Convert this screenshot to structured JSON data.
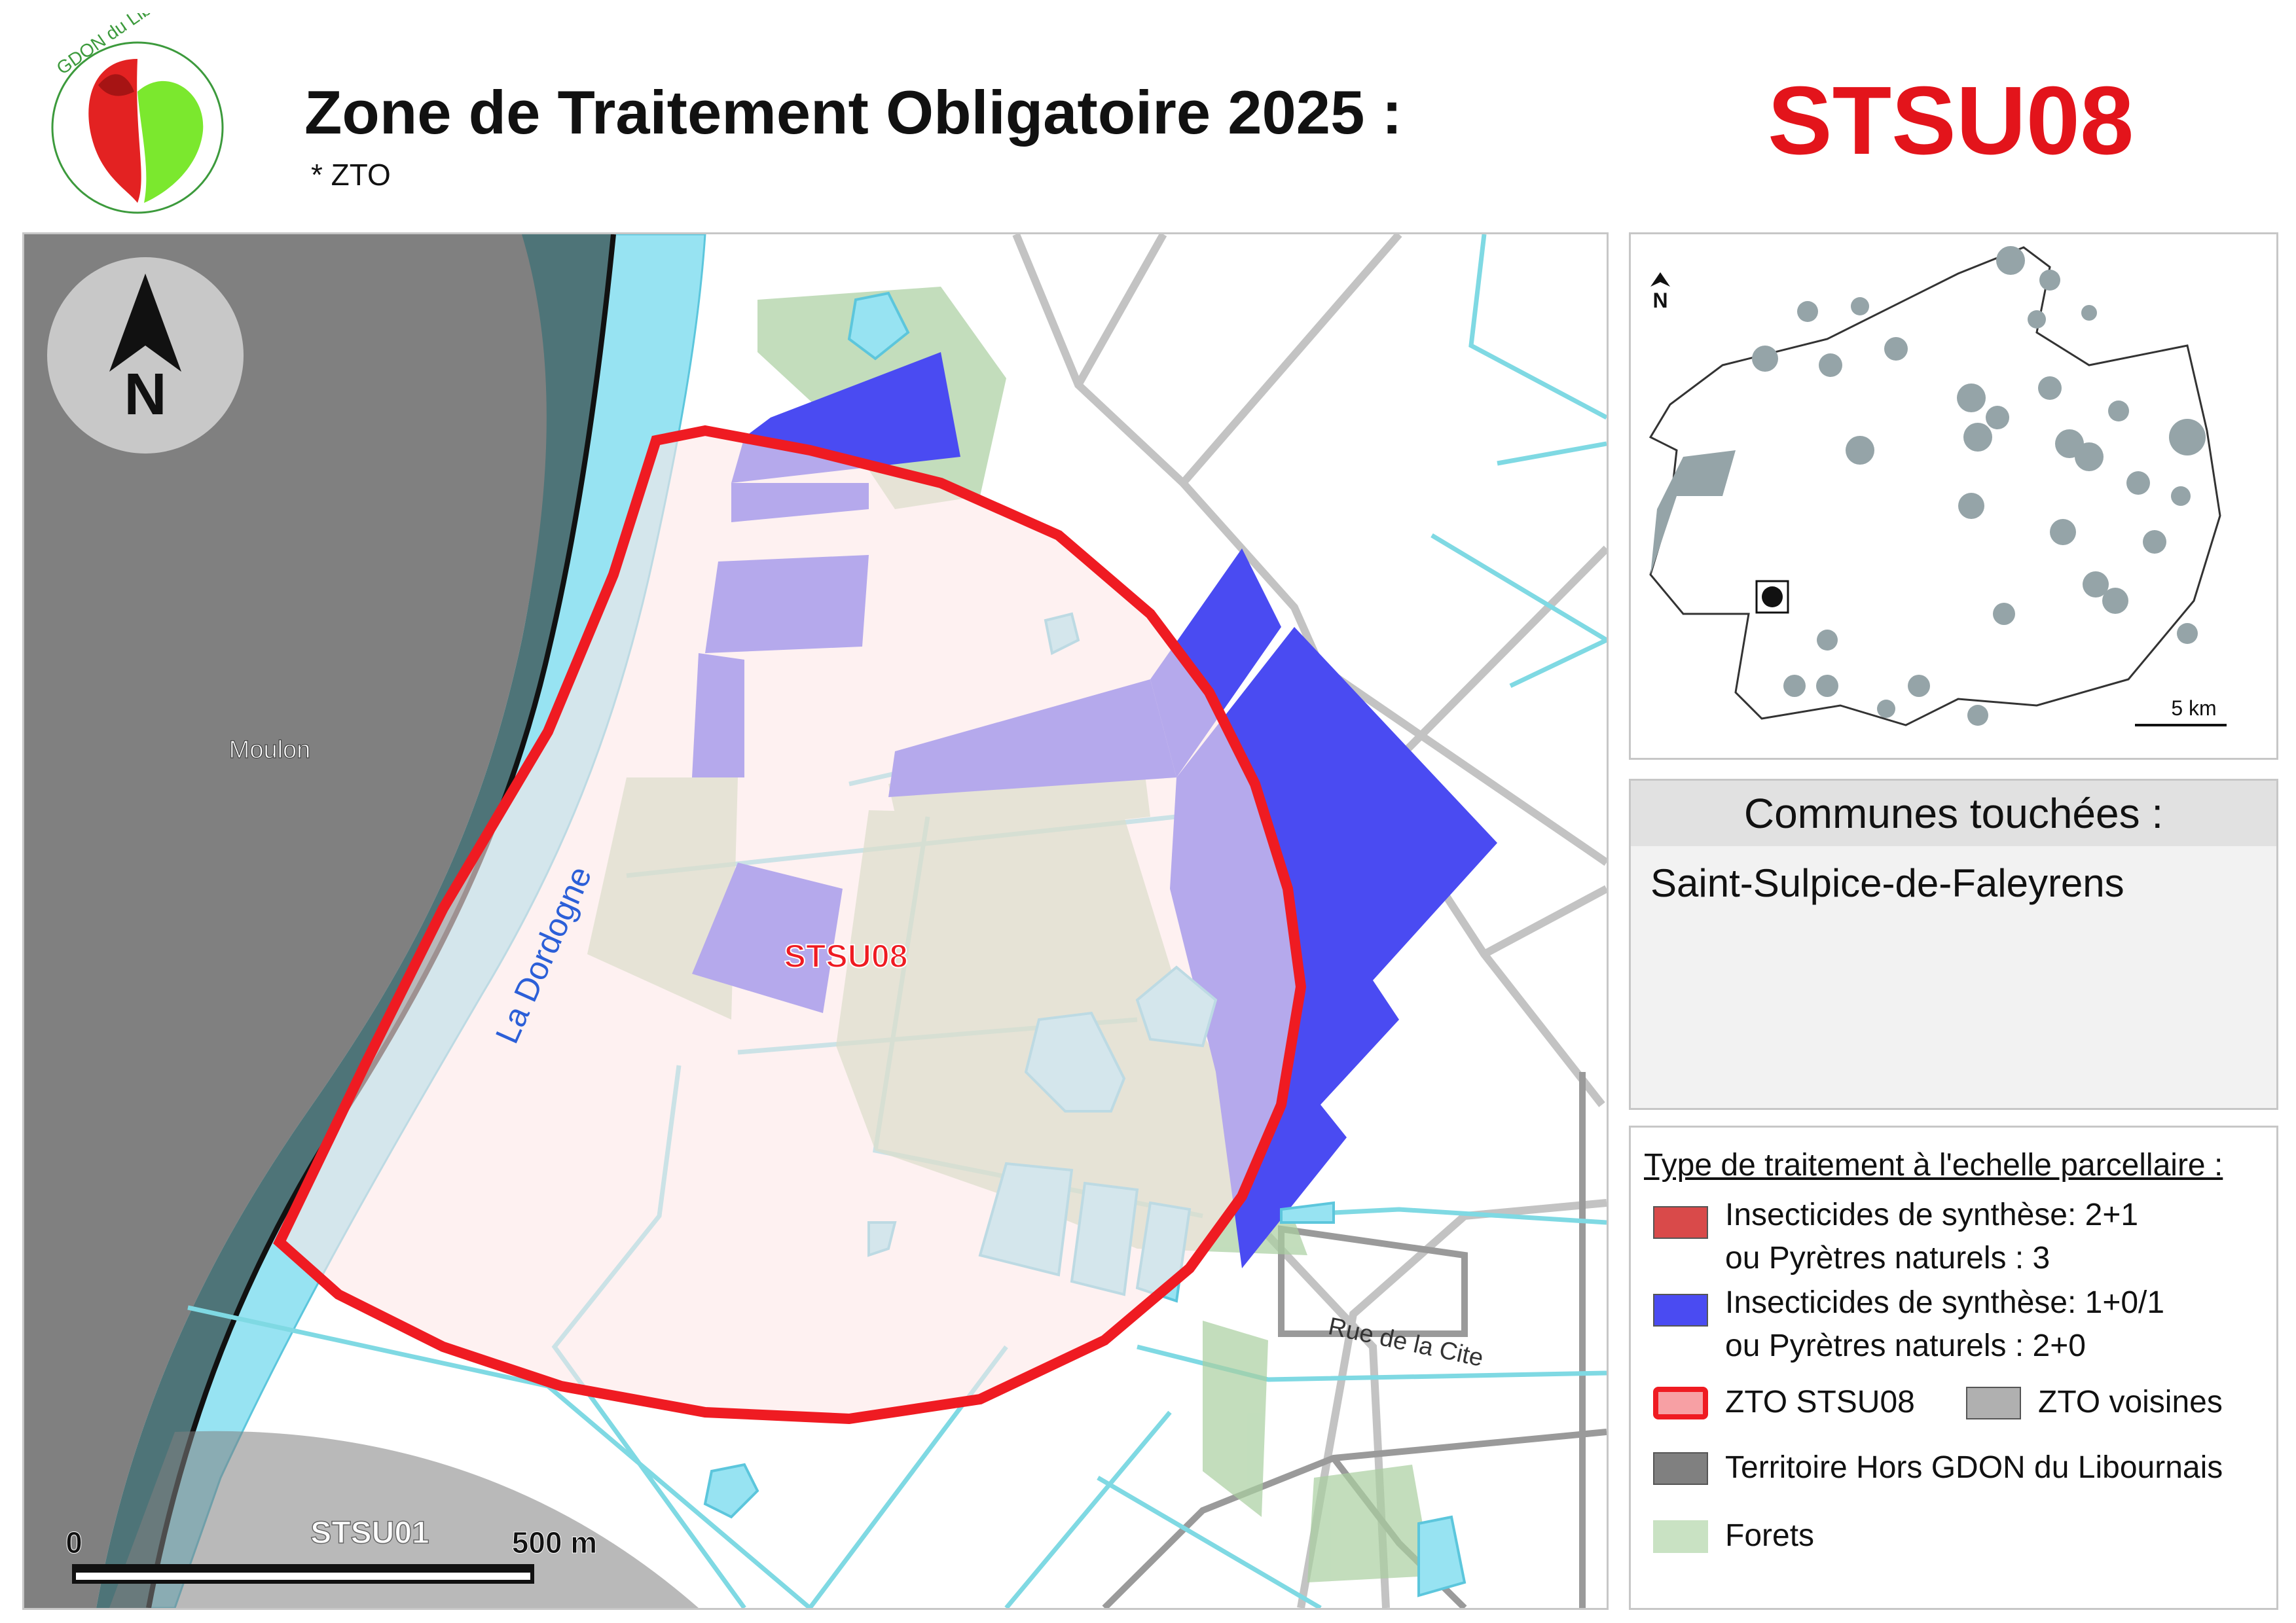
{
  "header": {
    "title": "Zone de Traitement Obligatoire 2025 :",
    "subtitle": "* ZTO",
    "zone_code": "STSU08",
    "logo_text": "GDON du Libournais"
  },
  "map": {
    "north_label": "N",
    "place_moulon": "Moulon",
    "river_label": "La Dordogne",
    "zone_label": "STSU08",
    "neighbor_label": "STSU01",
    "street_label": "Rue de la Cite",
    "scale_start": "0",
    "scale_end": "500 m"
  },
  "overview": {
    "north_label": "N",
    "scale_label": "5 km"
  },
  "communes": {
    "title": "Communes touchées :",
    "items": [
      "Saint-Sulpice-de-Faleyrens"
    ]
  },
  "legend": {
    "title": "Type de traitement à l'echelle parcellaire :",
    "red_line1": "Insecticides de synthèse: 2+1",
    "red_line2": "ou Pyrètres naturels : 3",
    "blue_line1": "Insecticides de synthèse: 1+0/1",
    "blue_line2": "ou Pyrètres naturels : 2+0",
    "zto_label": "ZTO STSU08",
    "zto_neighbors": "ZTO voisines",
    "outside": "Territoire Hors GDON du Libournais",
    "forest": "Forets"
  },
  "colors": {
    "accent_red": "#e3141b",
    "treatment_red": "#d94a4a",
    "treatment_blue": "#4a4bf2",
    "water": "#97e3f2",
    "outside_gdon": "#808080",
    "river_bank": "#4e7478",
    "forest": "#a9cfa0"
  }
}
